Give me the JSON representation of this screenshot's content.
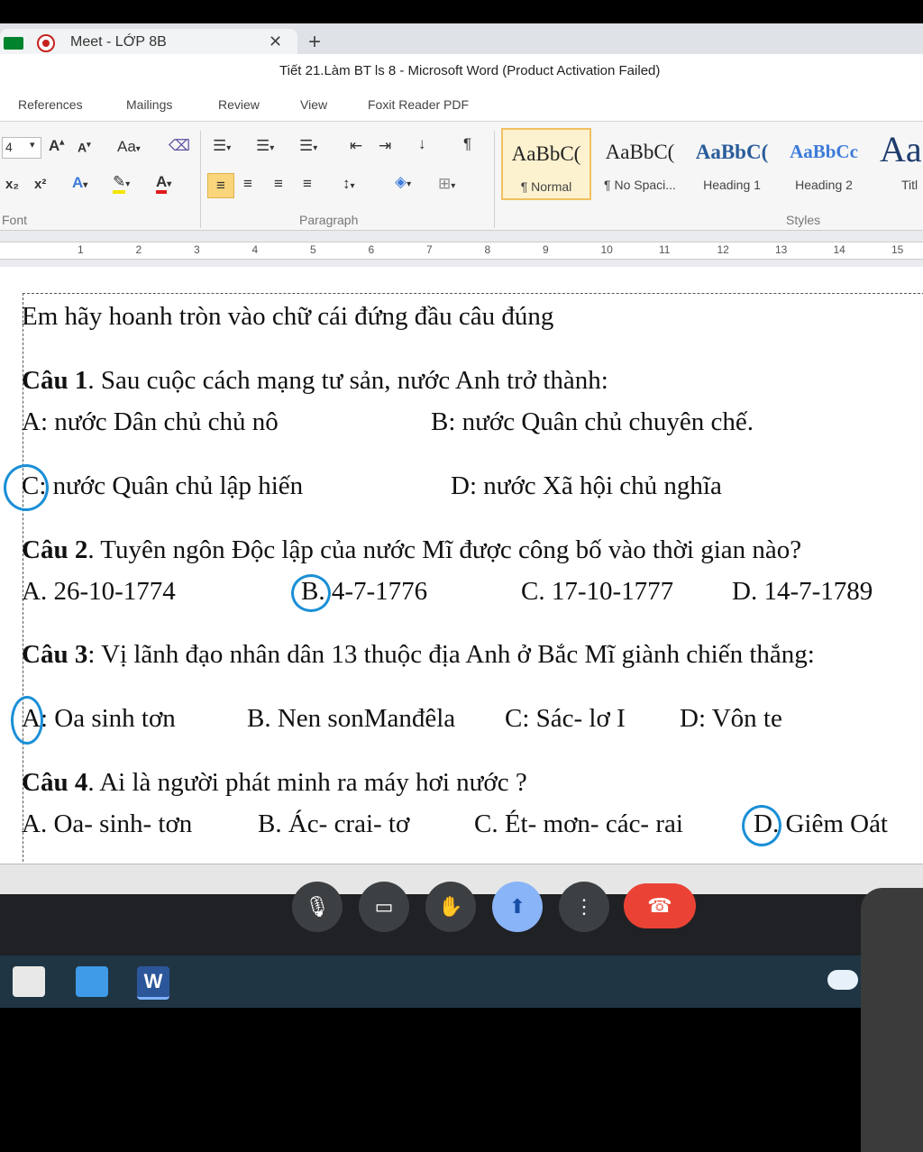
{
  "browser": {
    "tab_title": "Meet - LỚP 8B",
    "tab_close": "✕",
    "new_tab": "+"
  },
  "word": {
    "window_title": "Tiết 21.Làm BT ls 8  -  Microsoft Word (Product Activation Failed)",
    "ribbon_tabs": [
      "References",
      "Mailings",
      "Review",
      "View",
      "Foxit Reader PDF"
    ],
    "groups": {
      "font": "Font",
      "paragraph": "Paragraph",
      "styles": "Styles"
    },
    "font_controls": {
      "size": "4",
      "grow": "A",
      "shrink": "A",
      "case": "Aa",
      "subscript": "x₂",
      "superscript": "x²"
    },
    "styles": [
      {
        "sample": "AaBbC(",
        "name": "¶ Normal"
      },
      {
        "sample": "AaBbC(",
        "name": "¶ No Spaci..."
      },
      {
        "sample": "AaBbC(",
        "name": "Heading 1"
      },
      {
        "sample": "AaBbCc",
        "name": "Heading 2"
      },
      {
        "sample": "Aa",
        "name": "Titl"
      }
    ],
    "ruler_numbers": [
      "1",
      "2",
      "3",
      "4",
      "5",
      "6",
      "7",
      "8",
      "9",
      "10",
      "11",
      "12",
      "13",
      "14",
      "15"
    ]
  },
  "doc": {
    "instruction": "Em hãy hoanh tròn vào chữ cái đứng đầu câu đúng",
    "q1": {
      "label": "Câu 1",
      "text": ". Sau cuộc cách mạng tư sản, nước Anh trở thành:",
      "a": "A: nước Dân chủ chủ nô",
      "b": "B: nước Quân chủ chuyên chế.",
      "c": "C: nước Quân chủ lập hiến",
      "d": "D: nước Xã hội chủ nghĩa"
    },
    "q2": {
      "label": "Câu 2",
      "text": ". Tuyên ngôn Độc lập của nước Mĩ được công bố vào thời gian nào?",
      "a": "A. 26-10-1774",
      "b": "B. 4-7-1776",
      "c": "C. 17-10-1777",
      "d": "D. 14-7-1789"
    },
    "q3": {
      "label": "Câu 3",
      "text": ": Vị lãnh đạo nhân dân 13 thuộc địa Anh ở  Bắc Mĩ giành chiến thắng:",
      "a": "A: Oa sinh tơn",
      "b": "B. Nen sonManđêla",
      "c": "C:  Sác- lơ I",
      "d": "D: Vôn te"
    },
    "q4": {
      "label": "Câu 4",
      "text": ". Ai là người phát minh ra máy hơi nước ?",
      "a": "A. Oa- sinh- tơn",
      "b": "B. Ác- crai- tơ",
      "c": "C. Ét- mơn- các- rai",
      "d": "D. Giêm Oát"
    }
  },
  "accent_colors": {
    "circle": "#1a8fd6",
    "end_call": "#ea4335",
    "present": "#8ab4f8"
  }
}
